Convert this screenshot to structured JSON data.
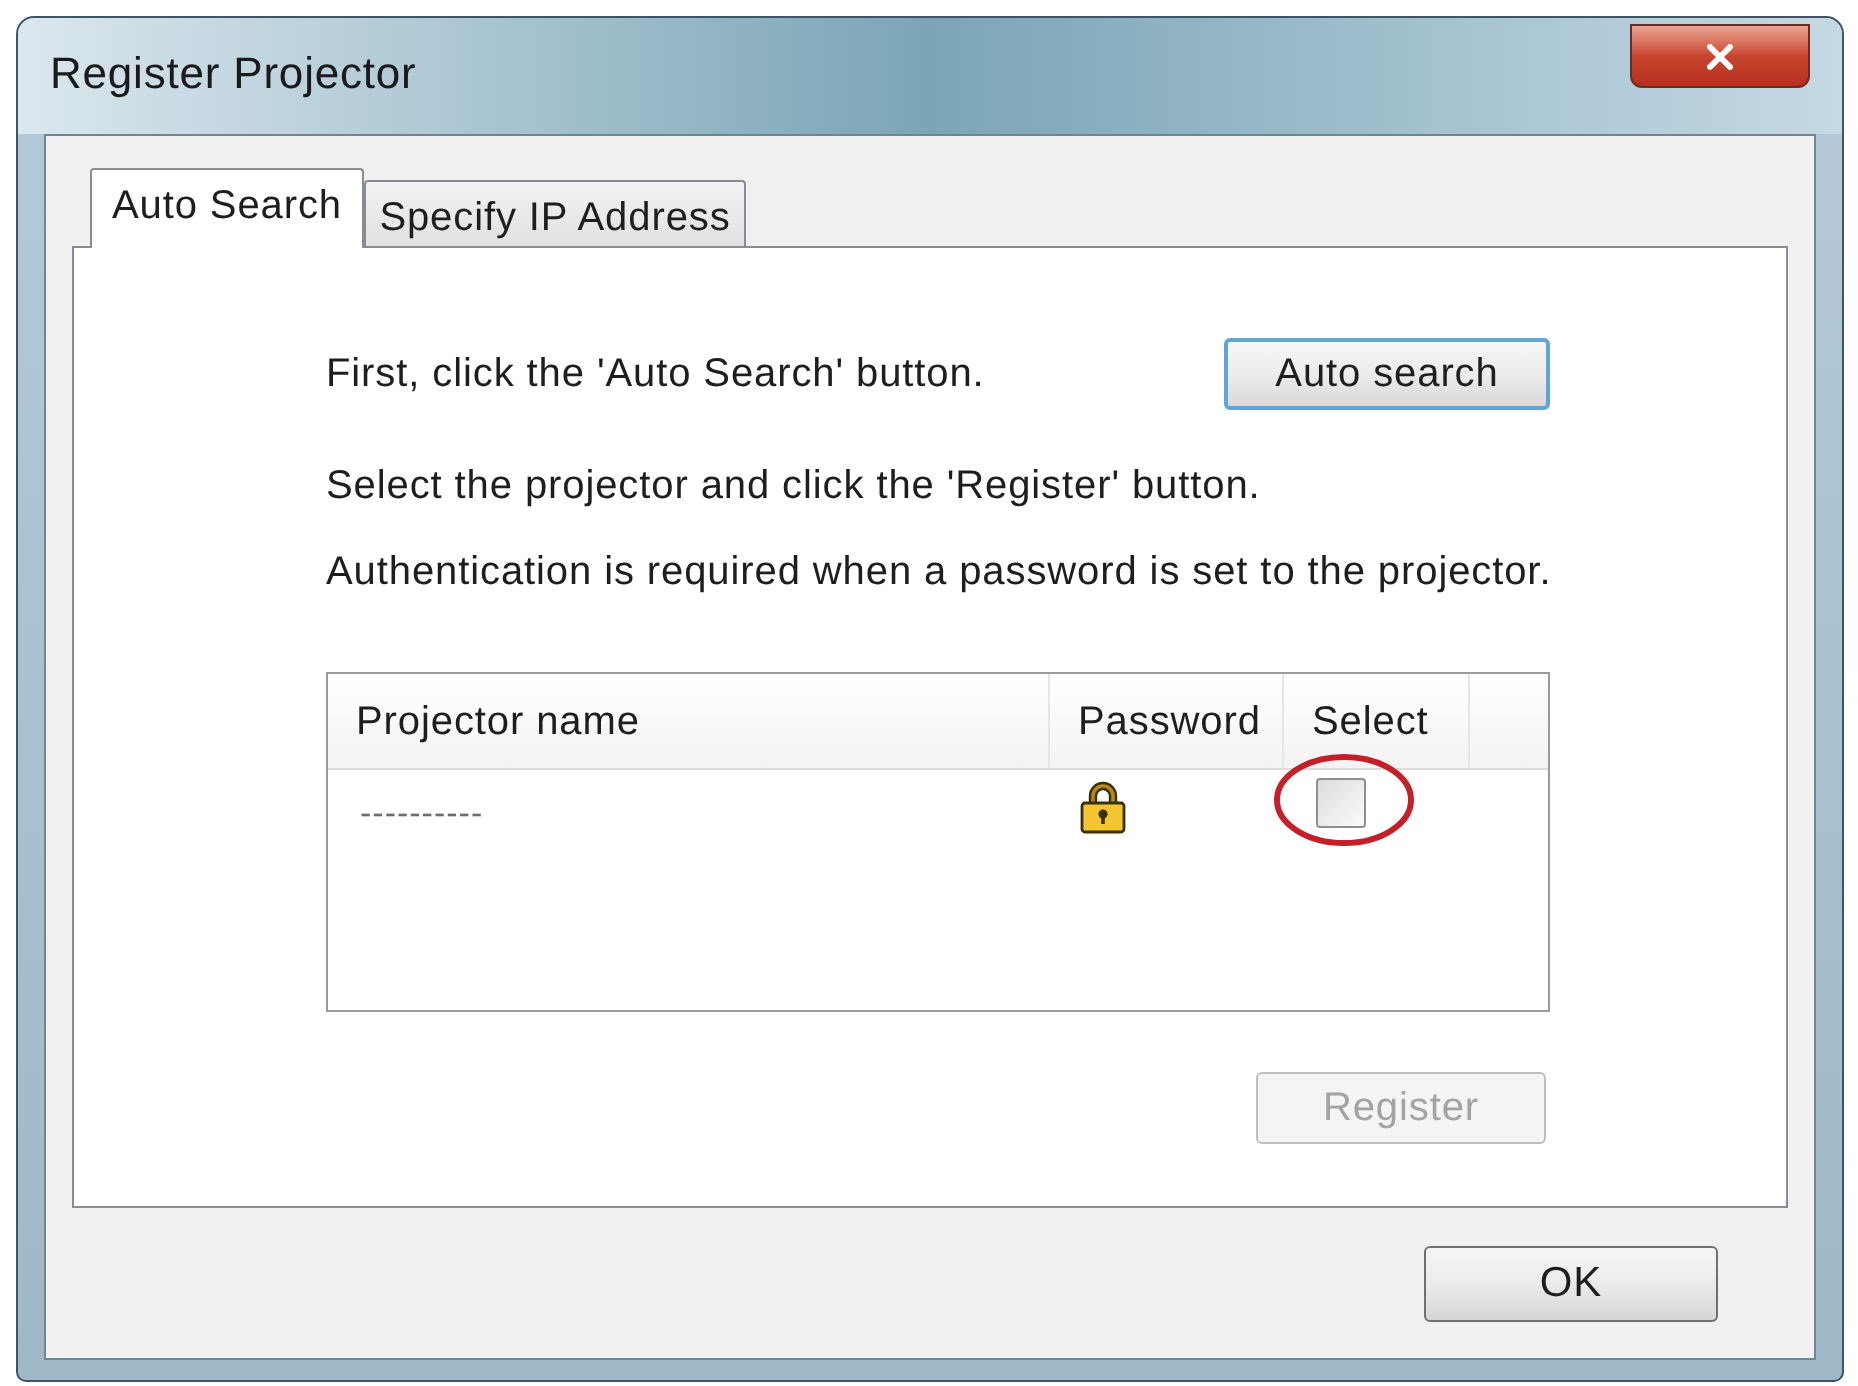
{
  "window": {
    "title": "Register Projector"
  },
  "tabs": [
    {
      "label": "Auto Search",
      "selected": true
    },
    {
      "label": "Specify IP Address",
      "selected": false
    }
  ],
  "instructions": [
    "First, click the 'Auto Search' button.",
    "Select the projector and click the 'Register' button.",
    "Authentication is required when a password is set to the projector."
  ],
  "auto_search_button": {
    "label": "Auto search",
    "focused": true,
    "disabled": false
  },
  "projector_table": {
    "columns": [
      "Projector name",
      "Password",
      "Select"
    ],
    "rows": [
      {
        "name": "----------",
        "password_protected": true,
        "checked": false,
        "highlighted": true
      }
    ]
  },
  "register_button": {
    "label": "Register",
    "disabled": true
  },
  "ok_button": {
    "label": "OK"
  }
}
